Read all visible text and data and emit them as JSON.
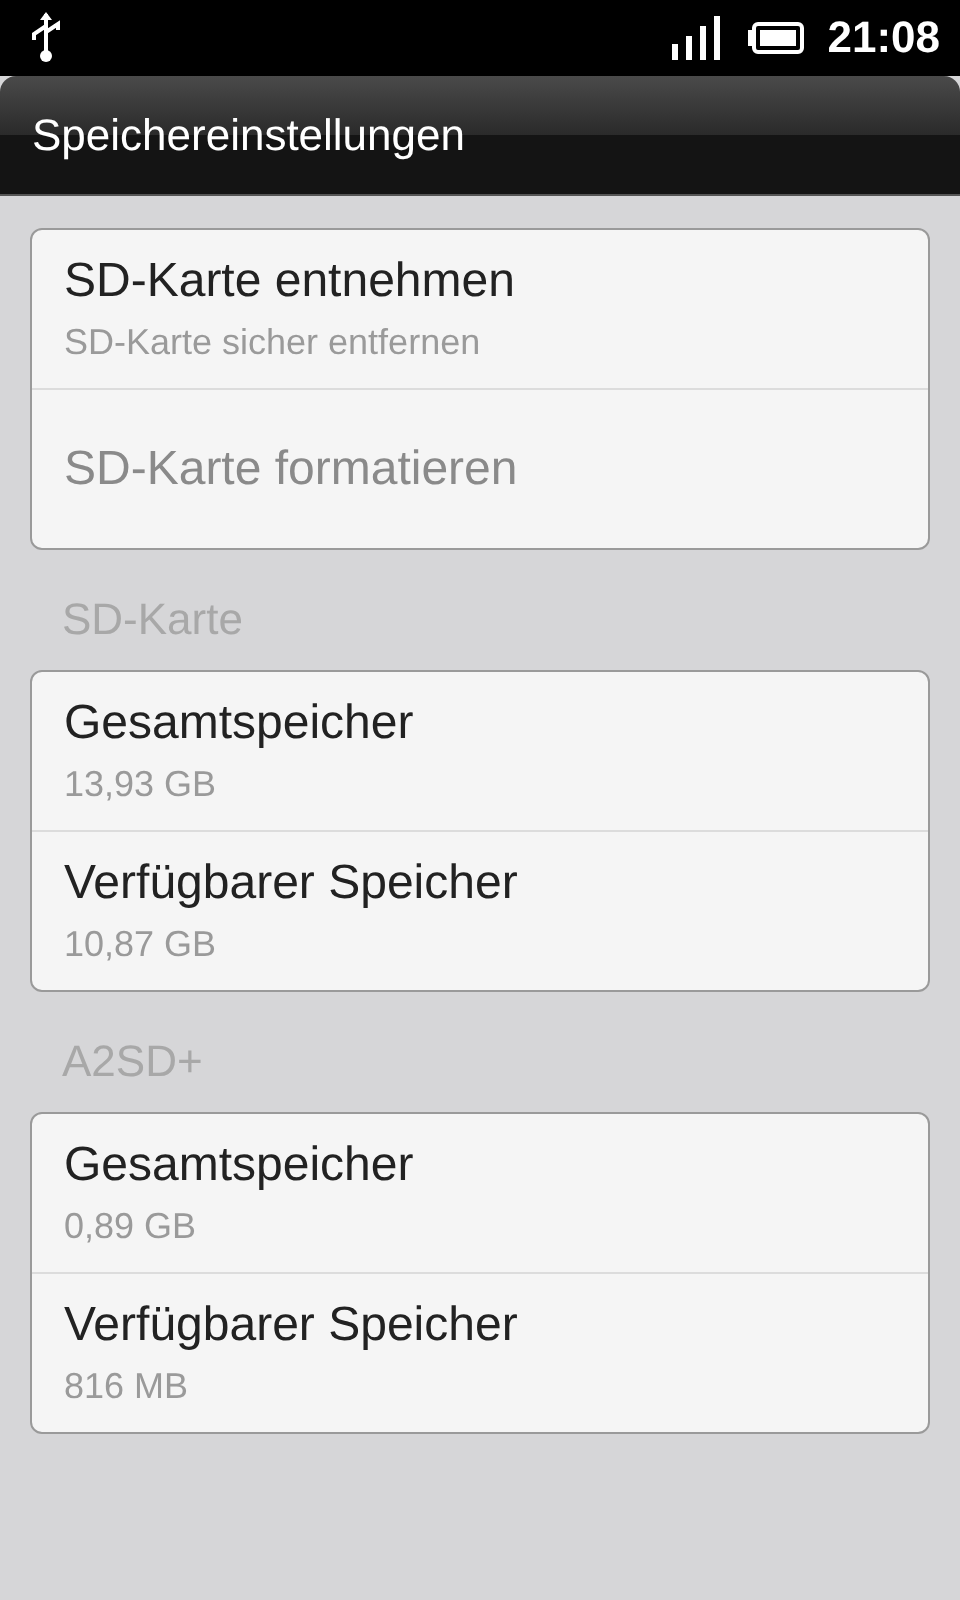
{
  "status_bar": {
    "time": "21:08"
  },
  "title_bar": {
    "title": "Speichereinstellungen"
  },
  "groups": [
    {
      "items": [
        {
          "title": "SD-Karte entnehmen",
          "summary": "SD-Karte sicher entfernen",
          "disabled": false
        },
        {
          "title": "SD-Karte formatieren",
          "disabled": true
        }
      ]
    },
    {
      "header": "SD-Karte",
      "items": [
        {
          "title": "Gesamtspeicher",
          "summary": "13,93 GB",
          "disabled": false
        },
        {
          "title": "Verfügbarer Speicher",
          "summary": "10,87 GB",
          "disabled": false
        }
      ]
    },
    {
      "header": "A2SD+",
      "items": [
        {
          "title": "Gesamtspeicher",
          "summary": "0,89 GB",
          "disabled": false
        },
        {
          "title": "Verfügbarer Speicher",
          "summary": "816 MB",
          "disabled": false
        }
      ]
    }
  ]
}
